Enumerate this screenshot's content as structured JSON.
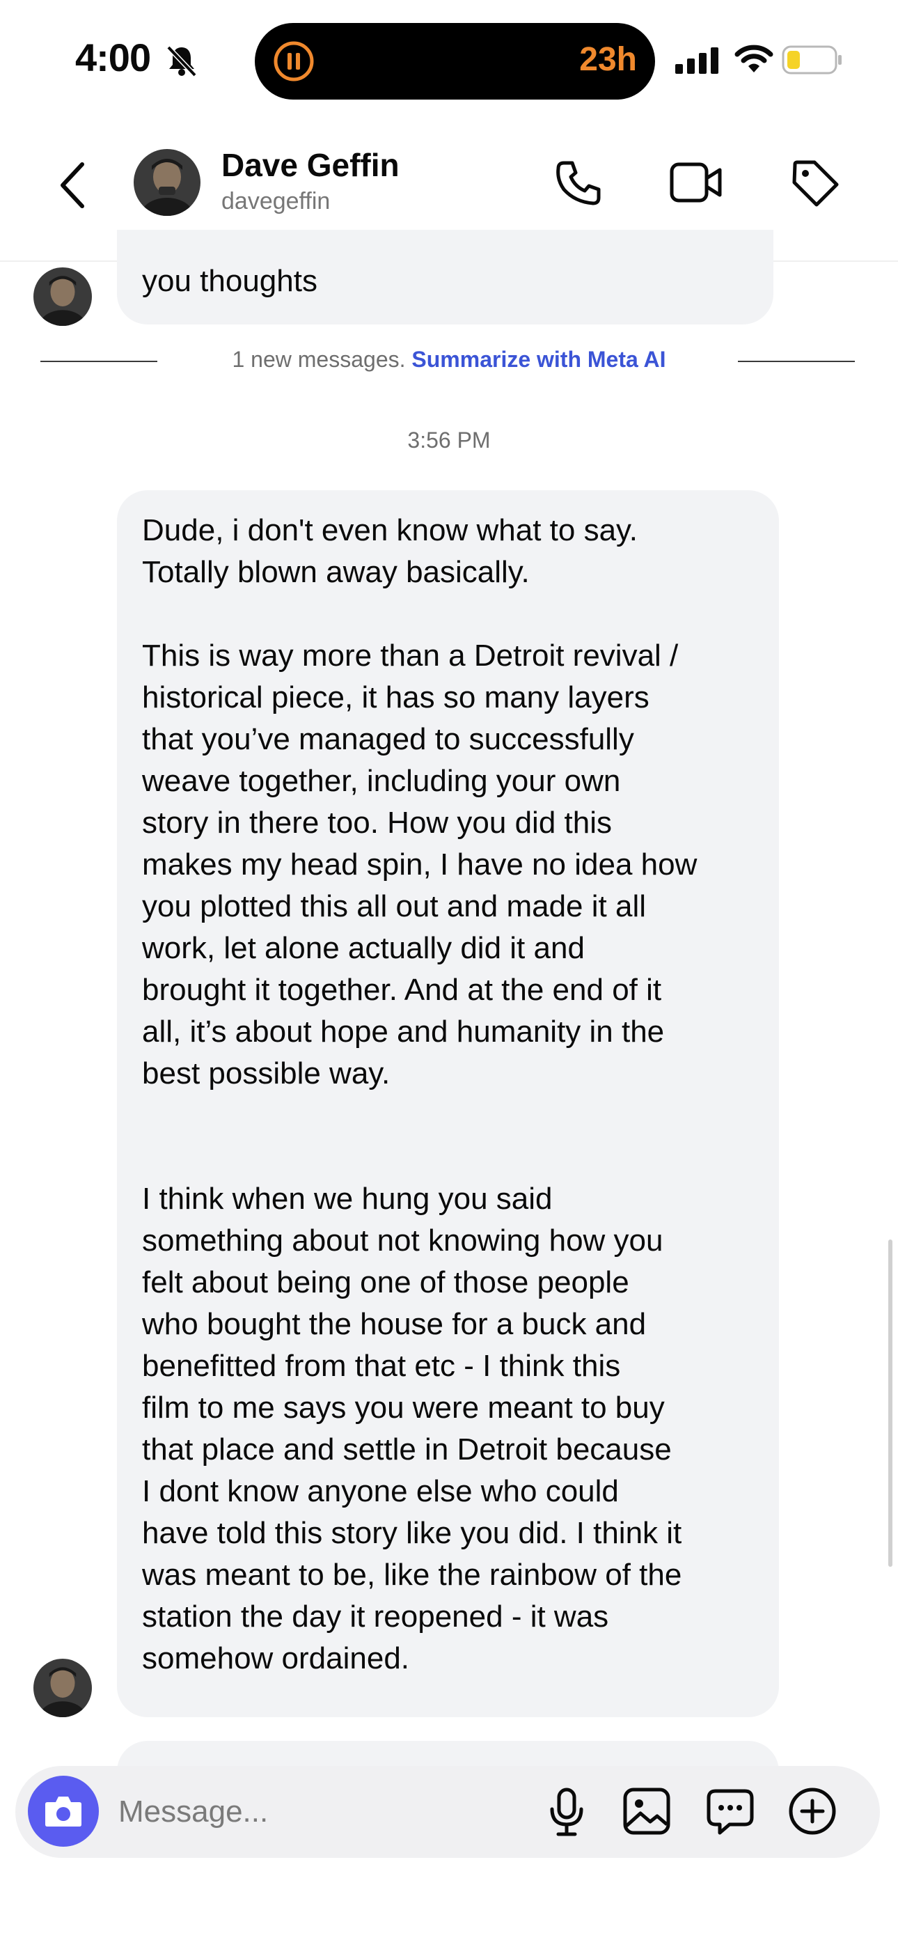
{
  "status_bar": {
    "time": "4:00",
    "island_timer": "23h",
    "battery_color": "#f5d327"
  },
  "header": {
    "contact_name": "Dave Geffin",
    "contact_handle": "davegeffin"
  },
  "conversation": {
    "previous_message": "you thoughts",
    "new_messages_notice": "1 new messages.",
    "summarize_link": "Summarize with Meta AI",
    "timestamp": "3:56 PM",
    "message_text": "Dude, i don't even know what to say.\nTotally blown away basically.\n\nThis is way more than a Detroit revival /\nhistorical piece, it has so many layers\nthat you’ve managed to successfully\nweave together, including your own\nstory in there too. How you did this\nmakes my head spin, I have no idea how\nyou plotted this all out and made it all\nwork, let alone actually did it and\nbrought it together. And at the end of it\nall, it’s about hope and humanity in the\nbest possible way.\n\n\nI think when we hung you said\nsomething about not knowing how you\nfelt about being one of those people\nwho bought the house for a buck and\nbenefitted from that etc - I think this\nfilm to me says you were meant to buy\nthat place and settle in Detroit because\nI dont know anyone else who could\nhave told this story like you did. I think it\nwas meant to be, like the rainbow of the\nstation the day it reopened - it was\nsomehow ordained."
  },
  "composer": {
    "placeholder": "Message...",
    "accent_color": "#5a5cf0"
  }
}
